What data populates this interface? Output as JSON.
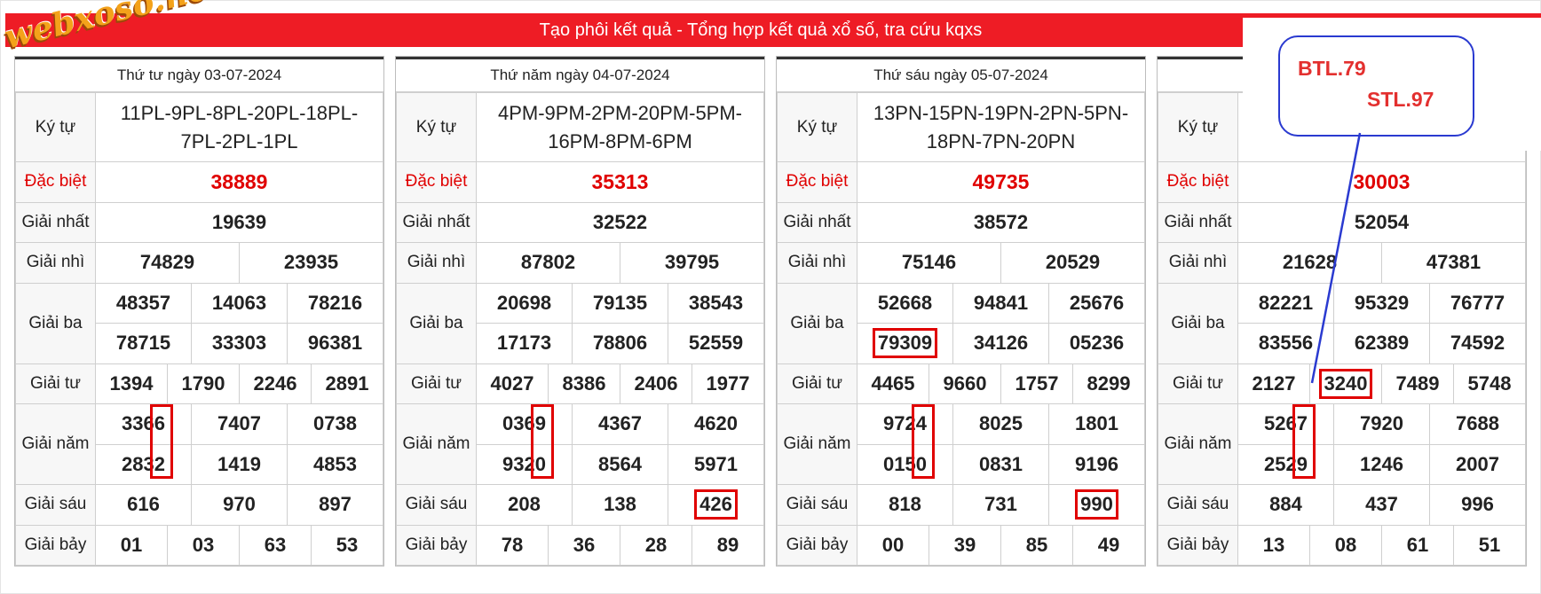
{
  "header": {
    "title": "Tạo phôi kết quả - Tổng hợp kết quả xổ số, tra cứu kqxs"
  },
  "logo": {
    "text": "webxoso.net"
  },
  "labels": {
    "kytu": "Ký tự",
    "db": "Đặc biệt",
    "g1": "Giải nhất",
    "g2": "Giải nhì",
    "g3": "Giải ba",
    "g4": "Giải tư",
    "g5": "Giải năm",
    "g6": "Giải sáu",
    "g7": "Giải bảy"
  },
  "boards": [
    {
      "date": "Thứ tư ngày 03-07-2024",
      "kytu": "11PL-9PL-8PL-20PL-18PL-7PL-2PL-1PL",
      "db": "38889",
      "g1": "19639",
      "g2": [
        "74829",
        "23935"
      ],
      "g3": [
        "48357",
        "14063",
        "78216",
        "78715",
        "33303",
        "96381"
      ],
      "g4": [
        "1394",
        "1790",
        "2246",
        "2891"
      ],
      "g5": [
        "3366",
        "7407",
        "0738",
        "2832",
        "1419",
        "4853"
      ],
      "g6": [
        "616",
        "970",
        "897"
      ],
      "g7": [
        "01",
        "03",
        "63",
        "53"
      ]
    },
    {
      "date": "Thứ năm ngày 04-07-2024",
      "kytu": "4PM-9PM-2PM-20PM-5PM-16PM-8PM-6PM",
      "db": "35313",
      "g1": "32522",
      "g2": [
        "87802",
        "39795"
      ],
      "g3": [
        "20698",
        "79135",
        "38543",
        "17173",
        "78806",
        "52559"
      ],
      "g4": [
        "4027",
        "8386",
        "2406",
        "1977"
      ],
      "g5": [
        "0369",
        "4367",
        "4620",
        "9320",
        "8564",
        "5971"
      ],
      "g6": [
        "208",
        "138",
        "426"
      ],
      "g7": [
        "78",
        "36",
        "28",
        "89"
      ]
    },
    {
      "date": "Thứ sáu ngày 05-07-2024",
      "kytu": "13PN-15PN-19PN-2PN-5PN-18PN-7PN-20PN",
      "db": "49735",
      "g1": "38572",
      "g2": [
        "75146",
        "20529"
      ],
      "g3": [
        "52668",
        "94841",
        "25676",
        "79309",
        "34126",
        "05236"
      ],
      "g4": [
        "4465",
        "9660",
        "1757",
        "8299"
      ],
      "g5": [
        "9724",
        "8025",
        "1801",
        "0150",
        "0831",
        "9196"
      ],
      "g6": [
        "818",
        "731",
        "990"
      ],
      "g7": [
        "00",
        "39",
        "85",
        "49"
      ]
    },
    {
      "date": "",
      "kytu": "",
      "db": "30003",
      "g1": "52054",
      "g2": [
        "21628",
        "47381"
      ],
      "g3": [
        "82221",
        "95329",
        "76777",
        "83556",
        "62389",
        "74592"
      ],
      "g4": [
        "2127",
        "3240",
        "7489",
        "5748"
      ],
      "g5": [
        "5267",
        "7920",
        "7688",
        "2529",
        "1246",
        "2007"
      ],
      "g6": [
        "884",
        "437",
        "996"
      ],
      "g7": [
        "13",
        "08",
        "61",
        "51"
      ]
    }
  ],
  "callout": {
    "line1": "BTL.79",
    "line2": "STL.97"
  },
  "colors": {
    "header": "#ee1c25",
    "special": "#e00000",
    "box": "#e00000",
    "callout_border": "#2a3ad0",
    "callout_text": "#e3302f",
    "logo": "#f4a21a"
  }
}
